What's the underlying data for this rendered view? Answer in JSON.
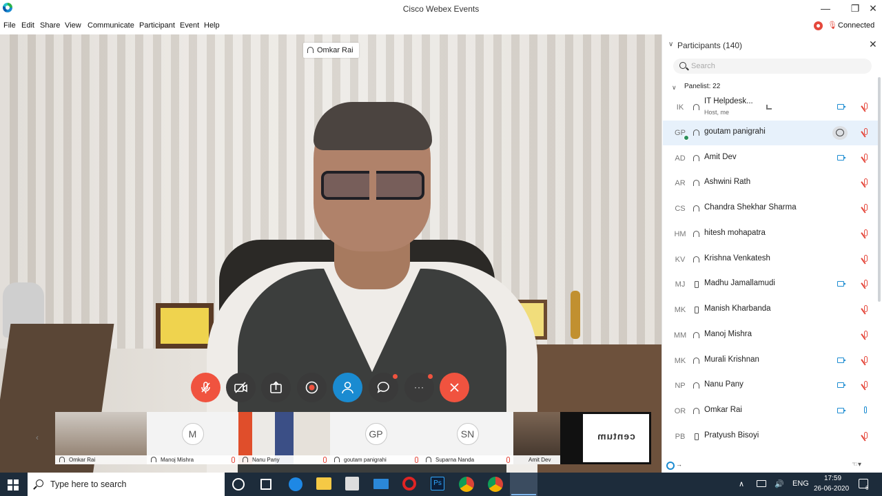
{
  "window": {
    "title": "Cisco Webex Events",
    "minimize": "—",
    "restore": "❐",
    "close": "✕"
  },
  "menu": [
    "File",
    "Edit",
    "Share",
    "View",
    "Communicate",
    "Participant",
    "Event",
    "Help"
  ],
  "connection": {
    "status": "Connected"
  },
  "stage": {
    "active_speaker": "Omkar Rai"
  },
  "controls": {
    "more": "···"
  },
  "filmstrip": [
    {
      "type": "video",
      "name": "Omkar Rai",
      "muted": false
    },
    {
      "type": "avatar",
      "initials": "M",
      "name": "Manoj Mishra",
      "muted": true
    },
    {
      "type": "video",
      "name": "Nanu Pany",
      "muted": true
    },
    {
      "type": "avatar",
      "initials": "GP",
      "name": "goutam panigrahi",
      "muted": true
    },
    {
      "type": "avatar",
      "initials": "SN",
      "name": "Suparna Nanda",
      "muted": true
    },
    {
      "type": "video",
      "name": "Amit Dev",
      "muted": false
    },
    {
      "type": "video",
      "name": "",
      "muted": false
    },
    {
      "type": "logo",
      "name": "",
      "logo_text": "centum"
    }
  ],
  "panel": {
    "title": "Participants (140)",
    "search_placeholder": "Search",
    "group_label": "Panelist: 22",
    "participants": [
      {
        "initials": "IK",
        "name": "IT Helpdesk...",
        "sub": "Host, me",
        "device": "headset",
        "video": true,
        "mic": "muted",
        "stats": true
      },
      {
        "initials": "GP",
        "name": "goutam panigrahi",
        "device": "headset",
        "chat": true,
        "mic": "muted",
        "selected": true,
        "badge": true
      },
      {
        "initials": "AD",
        "name": "Amit Dev",
        "device": "headset",
        "video": true,
        "mic": "muted"
      },
      {
        "initials": "AR",
        "name": "Ashwini Rath",
        "device": "headset",
        "mic": "muted"
      },
      {
        "initials": "CS",
        "name": "Chandra Shekhar Sharma",
        "device": "headset",
        "mic": "muted"
      },
      {
        "initials": "HM",
        "name": "hitesh mohapatra",
        "device": "headset",
        "mic": "muted"
      },
      {
        "initials": "KV",
        "name": "Krishna Venkatesh",
        "device": "headset",
        "mic": "muted"
      },
      {
        "initials": "MJ",
        "name": "Madhu Jamallamudi",
        "device": "phone",
        "video": true,
        "mic": "muted"
      },
      {
        "initials": "MK",
        "name": "Manish Kharbanda",
        "device": "phone",
        "mic": "muted"
      },
      {
        "initials": "MM",
        "name": "Manoj Mishra",
        "device": "headset",
        "mic": "muted"
      },
      {
        "initials": "MK",
        "name": "Murali Krishnan",
        "device": "headset",
        "video": true,
        "mic": "muted"
      },
      {
        "initials": "NP",
        "name": "Nanu Pany",
        "device": "headset",
        "video": true,
        "mic": "muted"
      },
      {
        "initials": "OR",
        "name": "Omkar Rai",
        "device": "headset",
        "video": true,
        "mic": "active"
      },
      {
        "initials": "PB",
        "name": "Pratyush Bisoyi",
        "device": "phone",
        "mic": "muted"
      }
    ]
  },
  "taskbar": {
    "search_text": "Type here to search",
    "language": "ENG",
    "time": "17:59",
    "date": "26-06-2020",
    "notifications": "6"
  },
  "colors": {
    "accent": "#1a8bd1",
    "danger": "#e5483c",
    "taskbar": "#1d2c3b",
    "selection": "#e7f1fb"
  }
}
